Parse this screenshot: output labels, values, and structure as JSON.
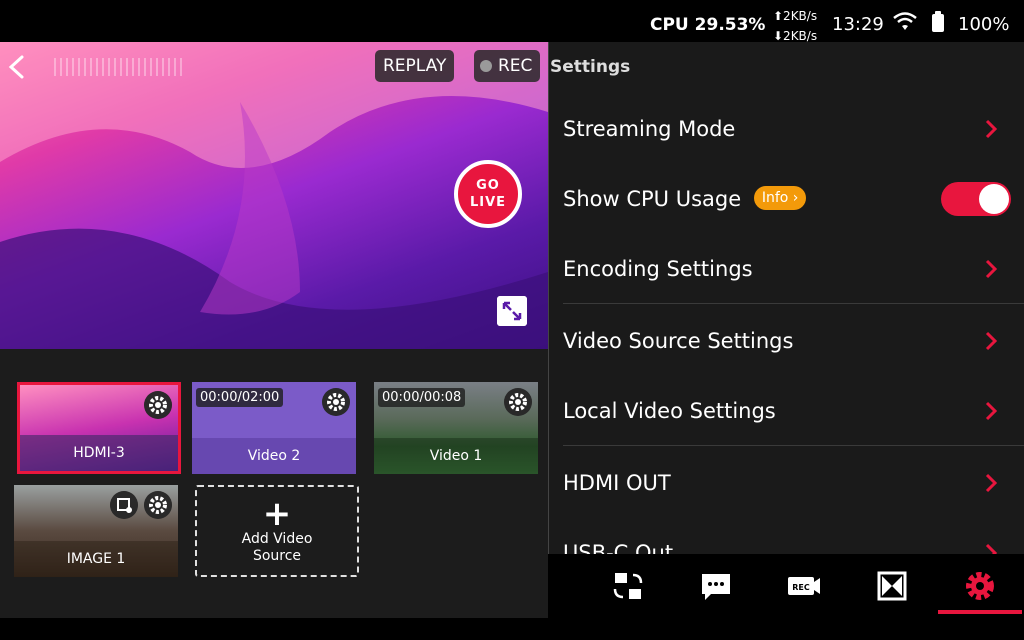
{
  "status": {
    "cpu": "CPU 29.53%",
    "upload": "⬆2KB/s",
    "download": "⬇2KB/s",
    "time": "13:29",
    "battery": "100%"
  },
  "preview": {
    "replay_label": "REPLAY",
    "rec_label": "REC",
    "go_live_line1": "GO",
    "go_live_line2": "LIVE"
  },
  "sources": [
    {
      "label": "HDMI-3",
      "selected": true
    },
    {
      "label": "Video 2",
      "time": "00:00/02:00"
    },
    {
      "label": "Video 1",
      "time": "00:00/00:08"
    },
    {
      "label": "IMAGE 1"
    }
  ],
  "add_source": {
    "line1": "Add Video",
    "line2": "Source"
  },
  "settings": {
    "header": "Settings",
    "rows": [
      {
        "label": "Streaming Mode"
      },
      {
        "label": "Show CPU Usage",
        "badge": "Info ›",
        "toggle_on": true
      },
      {
        "label": "Encoding Settings"
      },
      {
        "label": "Video Source Settings"
      },
      {
        "label": "Local Video Settings"
      },
      {
        "label": "HDMI OUT"
      },
      {
        "label": "USB-C Out"
      }
    ]
  },
  "colors": {
    "accent": "#e8163e",
    "info_badge": "#f39a0a"
  },
  "nav_icons": [
    "switch-camera-icon",
    "chat-icon",
    "rec-icon",
    "layout-icon",
    "gear-icon"
  ]
}
